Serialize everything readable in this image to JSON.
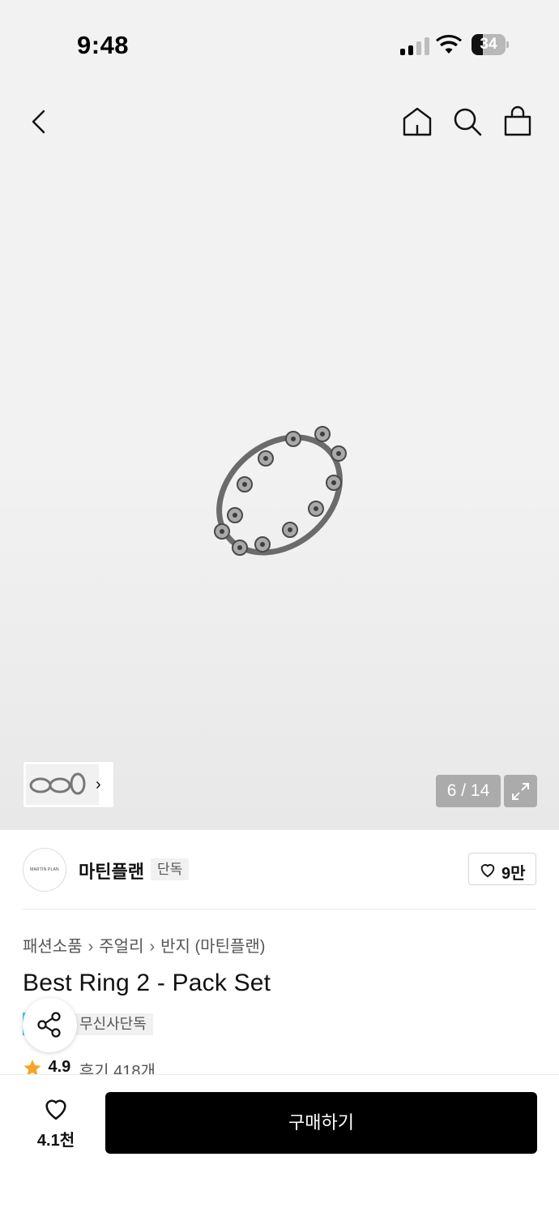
{
  "status_bar": {
    "time": "9:48",
    "battery": "34",
    "battery_level": 0.34
  },
  "header": {
    "back_icon": "chevron-left-icon",
    "home_icon": "home-icon",
    "search_icon": "search-icon",
    "cart_icon": "shopping-bag-icon"
  },
  "gallery": {
    "counter": "6 / 14",
    "thumb_arrow": "›"
  },
  "brand": {
    "logo_text": "MARTIN PLAN",
    "name": "마틴플랜",
    "tag": "단독",
    "likes": "9만"
  },
  "breadcrumb": [
    "패션소품",
    "주얼리",
    "반지 (마틴플랜)"
  ],
  "breadcrumb_sep": "›",
  "product": {
    "title": "Best Ring 2 - Pack Set",
    "badge": "무신사단독",
    "rating": "4.9",
    "reviews": "후기 418개"
  },
  "bottom_bar": {
    "wish_count": "4.1천",
    "buy_label": "구매하기"
  },
  "colors": {
    "badge_cyan": "#40c8ea",
    "star": "#f5a623",
    "buy_bg": "#000000"
  }
}
